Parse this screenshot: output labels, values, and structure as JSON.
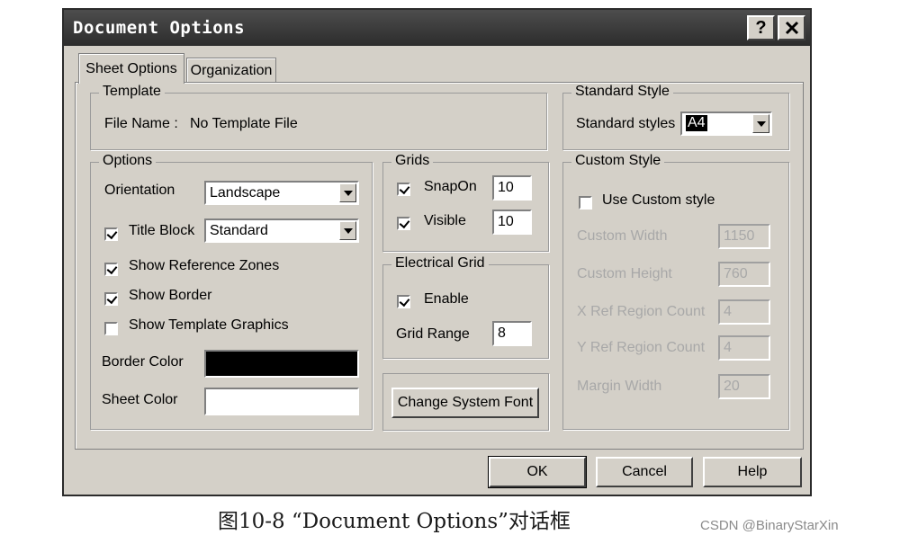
{
  "window": {
    "title": "Document Options"
  },
  "titlebar": {
    "help": "?",
    "close_icon": "close-x"
  },
  "tabs": [
    {
      "label": "Sheet Options",
      "active": true
    },
    {
      "label": "Organization",
      "active": false
    }
  ],
  "template": {
    "group": "Template",
    "file_name_label": "File Name :",
    "file_name_value": "No Template File"
  },
  "standard_style": {
    "group": "Standard Style",
    "label": "Standard styles",
    "value": "A4"
  },
  "options": {
    "group": "Options",
    "orientation_label": "Orientation",
    "orientation_value": "Landscape",
    "title_block_label": "Title Block",
    "title_block_checked": true,
    "title_block_value": "Standard",
    "show_reference_zones": "Show Reference Zones",
    "show_reference_zones_checked": true,
    "show_border": "Show Border",
    "show_border_checked": true,
    "show_template_graphics": "Show Template Graphics",
    "show_template_graphics_checked": false,
    "border_color_label": "Border Color",
    "border_color": "#000000",
    "sheet_color_label": "Sheet Color",
    "sheet_color": "#ffffff"
  },
  "grids": {
    "group": "Grids",
    "snap_label": "SnapOn",
    "snap_checked": true,
    "snap_value": "10",
    "visible_label": "Visible",
    "visible_checked": true,
    "visible_value": "10"
  },
  "electrical_grid": {
    "group": "Electrical Grid",
    "enable_label": "Enable",
    "enable_checked": true,
    "range_label": "Grid Range",
    "range_value": "8"
  },
  "change_font_button": "Change System Font",
  "custom_style": {
    "group": "Custom Style",
    "use_label": "Use Custom style",
    "use_checked": false,
    "width_label": "Custom Width",
    "width_value": "1150",
    "height_label": "Custom Height",
    "height_value": "760",
    "xref_label": "X Ref Region Count",
    "xref_value": "4",
    "yref_label": "Y Ref Region Count",
    "yref_value": "4",
    "margin_label": "Margin Width",
    "margin_value": "20"
  },
  "buttons": {
    "ok": "OK",
    "cancel": "Cancel",
    "help": "Help"
  },
  "caption": "图10-8 “Document Options”对话框",
  "watermark": "CSDN @BinaryStarXin"
}
